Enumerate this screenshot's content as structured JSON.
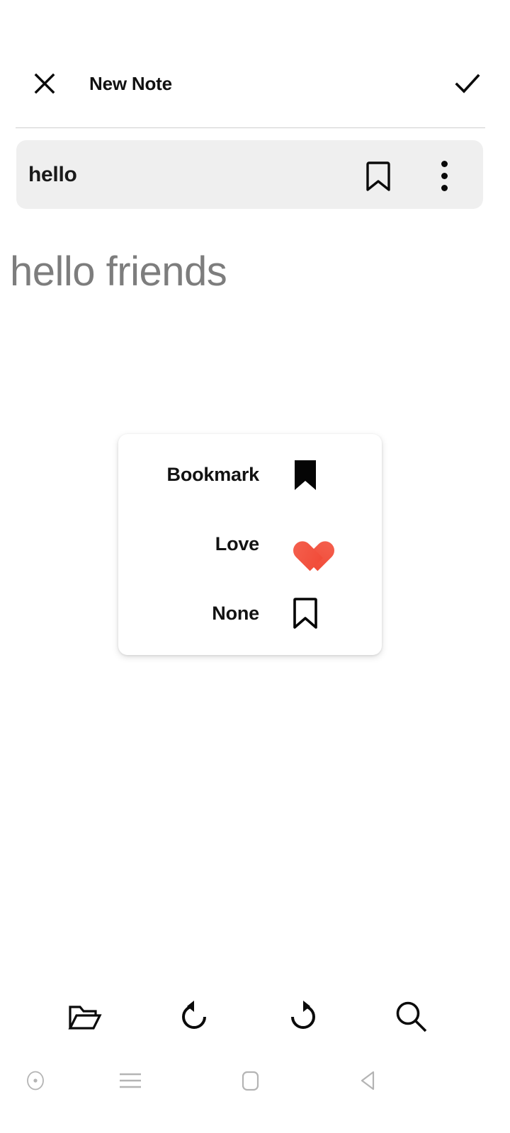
{
  "appbar": {
    "title": "New Note",
    "close_icon": "close-icon",
    "done_icon": "check-icon"
  },
  "title_field": {
    "value": "hello",
    "bookmark_icon": "bookmark-outline-icon",
    "overflow_icon": "more-vertical-icon"
  },
  "note": {
    "body": "hello friends"
  },
  "dialog": {
    "options": [
      {
        "label": "Bookmark",
        "icon": "bookmark-filled-icon"
      },
      {
        "label": "Love",
        "icon": "heart-icon"
      },
      {
        "label": "None",
        "icon": "bookmark-outline-icon"
      }
    ]
  },
  "toolbar": {
    "buttons": [
      {
        "name": "open-folder-icon"
      },
      {
        "name": "undo-icon"
      },
      {
        "name": "redo-icon"
      },
      {
        "name": "search-icon"
      }
    ]
  },
  "navbar": {
    "buttons": [
      {
        "name": "assistant-dot-icon"
      },
      {
        "name": "menu-icon"
      },
      {
        "name": "home-icon"
      },
      {
        "name": "back-icon"
      }
    ]
  },
  "colors": {
    "accent_heart": "#F14B38",
    "field_background": "#efefef",
    "body_text": "#7d7d7d",
    "primary_text": "#111111",
    "nav_icon": "#b0b0b0"
  }
}
